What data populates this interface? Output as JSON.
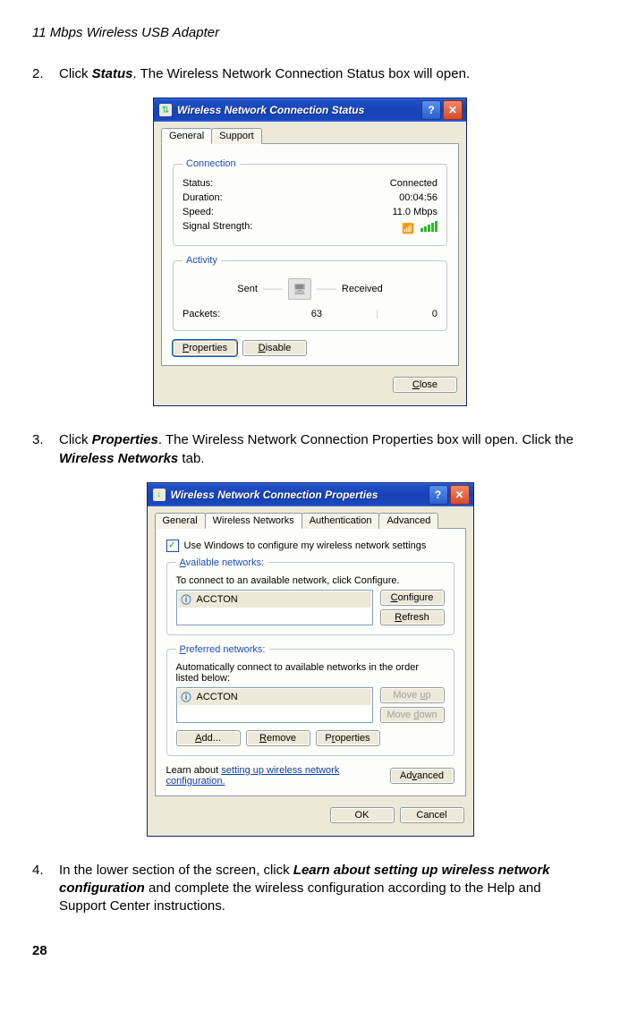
{
  "doc": {
    "title": "11 Mbps Wireless USB Adapter",
    "page_number": "28"
  },
  "steps": {
    "s2": {
      "num": "2.",
      "pre": "Click ",
      "em": "Status",
      "post": ". The Wireless Network Connection Status box will open."
    },
    "s3": {
      "num": "3.",
      "pre": "Click ",
      "em1": "Properties",
      "mid": ". The Wireless Network Connection Properties box will open. Click the ",
      "em2": "Wireless Networks",
      "post": " tab."
    },
    "s4": {
      "num": "4.",
      "pre": "In the lower section of the screen, click ",
      "em": "Learn about setting up wireless network configuration",
      "post": " and complete the wireless configuration according to the Help and Support Center instructions."
    }
  },
  "status_dialog": {
    "title": "Wireless Network Connection Status",
    "help": "?",
    "close": "✕",
    "tabs": {
      "general": "General",
      "support": "Support"
    },
    "connection": {
      "legend": "Connection",
      "status_lbl": "Status:",
      "status_val": "Connected",
      "duration_lbl": "Duration:",
      "duration_val": "00:04:56",
      "speed_lbl": "Speed:",
      "speed_val": "11.0 Mbps",
      "signal_lbl": "Signal Strength:"
    },
    "activity": {
      "legend": "Activity",
      "sent": "Sent",
      "received": "Received",
      "packets_lbl": "Packets:",
      "sent_val": "63",
      "recv_val": "0"
    },
    "buttons": {
      "properties": "Properties",
      "disable": "Disable",
      "close": "Close"
    }
  },
  "props_dialog": {
    "title": "Wireless Network Connection Properties",
    "help": "?",
    "close": "✕",
    "tabs": {
      "general": "General",
      "wireless": "Wireless Networks",
      "auth": "Authentication",
      "adv": "Advanced"
    },
    "use_windows": "Use Windows to configure my wireless network settings",
    "available": {
      "legend": "Available networks:",
      "desc": "To connect to an available network, click Configure.",
      "item": "ACCTON",
      "configure": "Configure",
      "refresh": "Refresh"
    },
    "preferred": {
      "legend": "Preferred networks:",
      "desc": "Automatically connect to available networks in the order listed below:",
      "item": "ACCTON",
      "move_up": "Move up",
      "move_down": "Move down",
      "add": "Add...",
      "remove": "Remove",
      "properties": "Properties"
    },
    "learn_pre": "Learn about ",
    "learn_link": "setting up wireless network configuration.",
    "advanced": "Advanced",
    "ok": "OK",
    "cancel": "Cancel"
  }
}
